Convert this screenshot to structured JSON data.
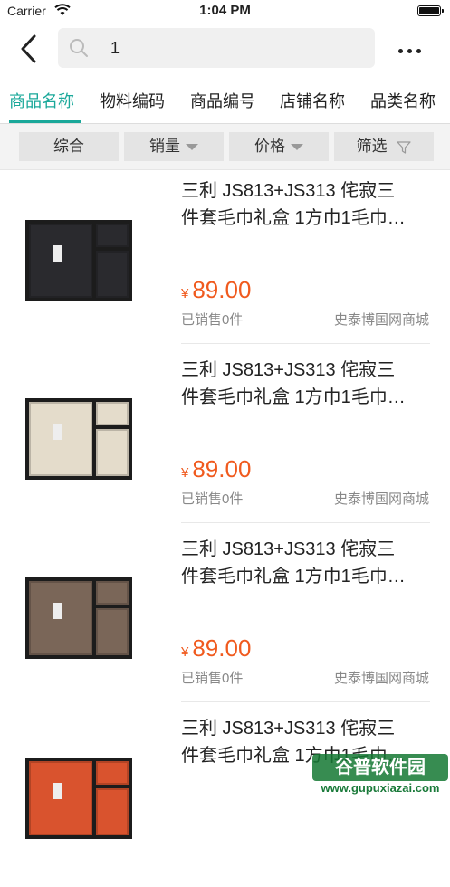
{
  "status_bar": {
    "carrier": "Carrier",
    "time": "1:04 PM"
  },
  "search": {
    "query": "1"
  },
  "tabs": [
    {
      "label": "商品名称",
      "active": true
    },
    {
      "label": "物料编码",
      "active": false
    },
    {
      "label": "商品编号",
      "active": false
    },
    {
      "label": "店铺名称",
      "active": false
    },
    {
      "label": "品类名称",
      "active": false
    }
  ],
  "sort": {
    "comprehensive": "综合",
    "sales": "销量",
    "price": "价格",
    "filter": "筛选"
  },
  "colors": {
    "accent": "#1aa89a",
    "price": "#f05a1e"
  },
  "products": [
    {
      "title_line1": "三利 JS813+JS313 侘寂三",
      "title_line2": "件套毛巾礼盒 1方巾1毛巾…",
      "currency": "¥",
      "price": "89.00",
      "sold": "已销售0件",
      "shop": "史泰博国网商城",
      "towel_color": "#2a2a2e"
    },
    {
      "title_line1": "三利 JS813+JS313 侘寂三",
      "title_line2": "件套毛巾礼盒 1方巾1毛巾…",
      "currency": "¥",
      "price": "89.00",
      "sold": "已销售0件",
      "shop": "史泰博国网商城",
      "towel_color": "#e4dccb"
    },
    {
      "title_line1": "三利 JS813+JS313 侘寂三",
      "title_line2": "件套毛巾礼盒 1方巾1毛巾…",
      "currency": "¥",
      "price": "89.00",
      "sold": "已销售0件",
      "shop": "史泰博国网商城",
      "towel_color": "#7a6658"
    },
    {
      "title_line1": "三利 JS813+JS313 侘寂三",
      "title_line2": "件套毛巾礼盒 1方巾1毛巾…",
      "currency": "¥",
      "price": "",
      "sold": "",
      "shop": "",
      "towel_color": "#d9532e"
    }
  ],
  "watermark": {
    "main": "谷普软件园",
    "sub": "www.gupuxiazai.com"
  }
}
